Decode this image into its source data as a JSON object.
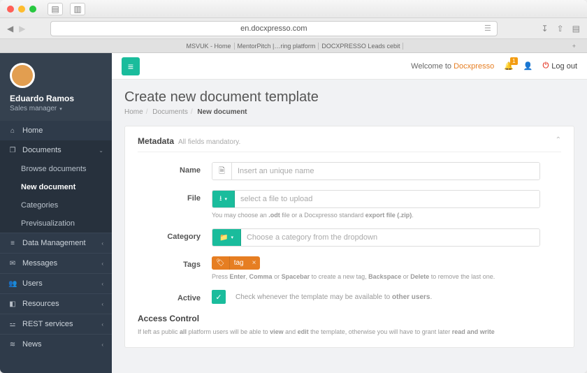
{
  "browser": {
    "url": "en.docxpresso.com",
    "tabs": [
      "MSVUK - Home",
      "MentorPitch |…ring platform",
      "DOCXPRESSO Leads cebit"
    ]
  },
  "user": {
    "name": "Eduardo Ramos",
    "role": "Sales manager"
  },
  "sidebar": {
    "home": "Home",
    "documents": "Documents",
    "subs": [
      "Browse documents",
      "New document",
      "Categories",
      "Previsualization"
    ],
    "data": "Data Management",
    "msg": "Messages",
    "users": "Users",
    "res": "Resources",
    "rest": "REST services",
    "news": "News"
  },
  "topbar": {
    "welcome": "Welcome to ",
    "brand": "Docxpresso",
    "badge": "1",
    "logout": "Log out"
  },
  "page": {
    "title": "Create new document template",
    "bc_home": "Home",
    "bc_docs": "Documents",
    "bc_cur": "New document"
  },
  "panel": {
    "title": "Metadata",
    "hint": "All fields mandatory.",
    "name_label": "Name",
    "name_ph": "Insert an unique name",
    "file_label": "File",
    "file_ph": "select a file to upload",
    "file_help_pre": "You may choose an ",
    "file_help_odt": ".odt",
    "file_help_mid": " file or a Docxpresso standard ",
    "file_help_exp": "export file (.zip)",
    "cat_label": "Category",
    "cat_ph": "Choose a category from the dropdown",
    "tags_label": "Tags",
    "tag_value": "tag",
    "tags_help_1": "Press ",
    "tags_help_enter": "Enter",
    "tags_help_2": ", ",
    "tags_help_comma": "Comma",
    "tags_help_3": " or ",
    "tags_help_space": "Spacebar",
    "tags_help_4": " to create a new tag, ",
    "tags_help_back": "Backspace",
    "tags_help_5": " or ",
    "tags_help_del": "Delete",
    "tags_help_6": " to remove the last one.",
    "active_label": "Active",
    "active_help_1": "Check whenever the template may be available to ",
    "active_help_2": "other users",
    "ac_title": "Access Control",
    "ac_note_1": "If left as public ",
    "ac_note_2": "all",
    "ac_note_3": " platform users will be able to ",
    "ac_note_4": "view",
    "ac_note_5": " and ",
    "ac_note_6": "edit",
    "ac_note_7": " the template, otherwise you will have to grant later ",
    "ac_note_8": "read and write"
  }
}
